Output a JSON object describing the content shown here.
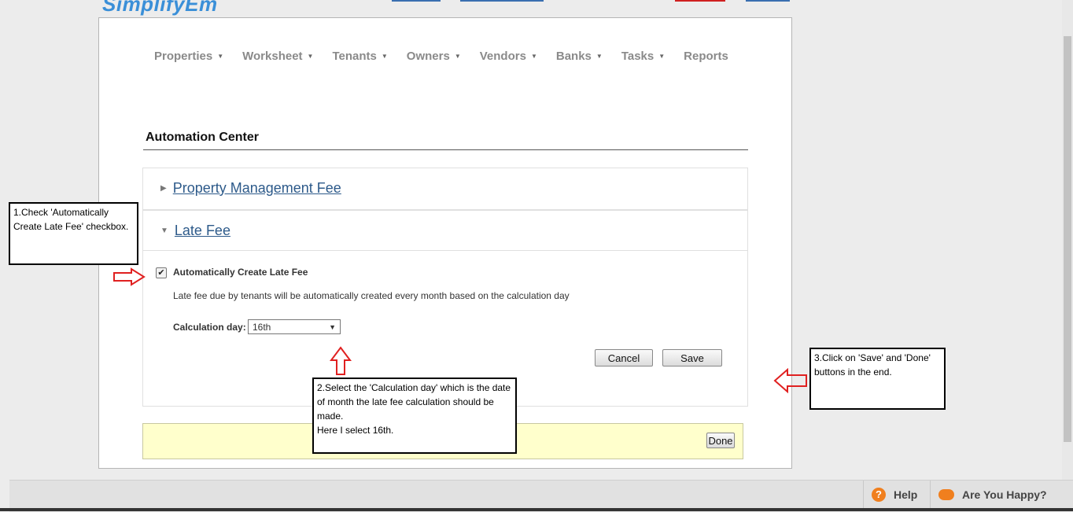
{
  "app": {
    "logo": "SimplifyEm"
  },
  "nav": {
    "items": [
      {
        "label": "Properties",
        "dropdown": true
      },
      {
        "label": "Worksheet",
        "dropdown": true
      },
      {
        "label": "Tenants",
        "dropdown": true
      },
      {
        "label": "Owners",
        "dropdown": true
      },
      {
        "label": "Vendors",
        "dropdown": true
      },
      {
        "label": "Banks",
        "dropdown": true
      },
      {
        "label": "Tasks",
        "dropdown": true
      },
      {
        "label": "Reports",
        "dropdown": false
      }
    ]
  },
  "page": {
    "title": "Automation Center"
  },
  "sections": {
    "pm_fee": {
      "label": "Property Management Fee",
      "expanded": false
    },
    "late_fee": {
      "label": "Late Fee",
      "expanded": true,
      "checkbox_label": "Automatically Create Late Fee",
      "checkbox_checked": true,
      "description": "Late fee due by tenants will be automatically created every month based on the calculation day",
      "calc_label": "Calculation day:",
      "calc_value": "16th",
      "cancel_label": "Cancel",
      "save_label": "Save"
    }
  },
  "done_label": "Done",
  "annotations": {
    "step1": "1.Check 'Automatically Create Late Fee' checkbox.",
    "step2_a": "2.Select the 'Calculation day' which is the date of month the late fee calculation should be made.",
    "step2_b": "Here I select 16th.",
    "step3": "3.Click on 'Save' and 'Done' buttons in the end."
  },
  "footer": {
    "help": "Help",
    "happy": "Are You Happy?"
  },
  "colors": {
    "link": "#2d5a8a",
    "arrow": "#e02020",
    "accent": "#f07f1e"
  }
}
